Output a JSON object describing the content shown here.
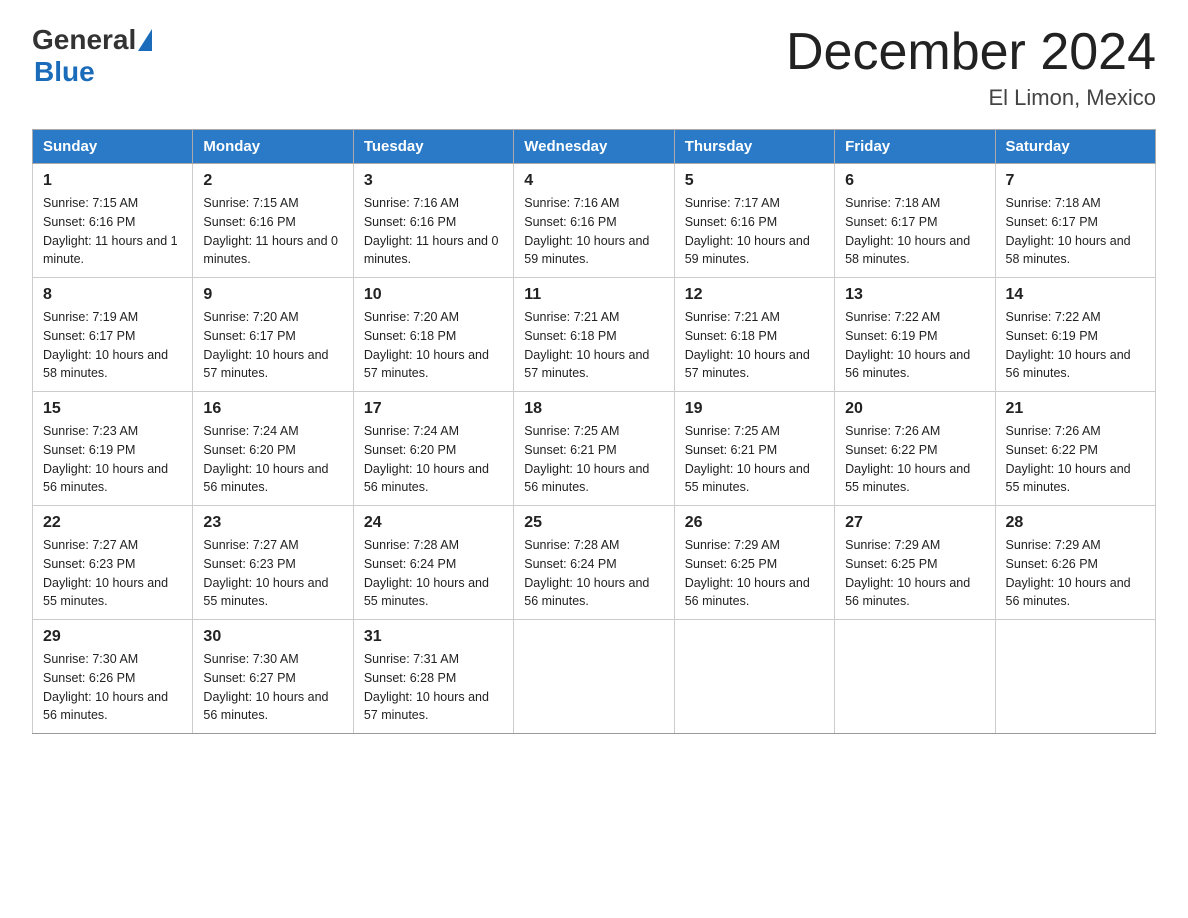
{
  "header": {
    "logo_general": "General",
    "logo_blue": "Blue",
    "month_title": "December 2024",
    "location": "El Limon, Mexico"
  },
  "days_of_week": [
    "Sunday",
    "Monday",
    "Tuesday",
    "Wednesday",
    "Thursday",
    "Friday",
    "Saturday"
  ],
  "weeks": [
    [
      {
        "day": "1",
        "sunrise": "7:15 AM",
        "sunset": "6:16 PM",
        "daylight": "11 hours and 1 minute."
      },
      {
        "day": "2",
        "sunrise": "7:15 AM",
        "sunset": "6:16 PM",
        "daylight": "11 hours and 0 minutes."
      },
      {
        "day": "3",
        "sunrise": "7:16 AM",
        "sunset": "6:16 PM",
        "daylight": "11 hours and 0 minutes."
      },
      {
        "day": "4",
        "sunrise": "7:16 AM",
        "sunset": "6:16 PM",
        "daylight": "10 hours and 59 minutes."
      },
      {
        "day": "5",
        "sunrise": "7:17 AM",
        "sunset": "6:16 PM",
        "daylight": "10 hours and 59 minutes."
      },
      {
        "day": "6",
        "sunrise": "7:18 AM",
        "sunset": "6:17 PM",
        "daylight": "10 hours and 58 minutes."
      },
      {
        "day": "7",
        "sunrise": "7:18 AM",
        "sunset": "6:17 PM",
        "daylight": "10 hours and 58 minutes."
      }
    ],
    [
      {
        "day": "8",
        "sunrise": "7:19 AM",
        "sunset": "6:17 PM",
        "daylight": "10 hours and 58 minutes."
      },
      {
        "day": "9",
        "sunrise": "7:20 AM",
        "sunset": "6:17 PM",
        "daylight": "10 hours and 57 minutes."
      },
      {
        "day": "10",
        "sunrise": "7:20 AM",
        "sunset": "6:18 PM",
        "daylight": "10 hours and 57 minutes."
      },
      {
        "day": "11",
        "sunrise": "7:21 AM",
        "sunset": "6:18 PM",
        "daylight": "10 hours and 57 minutes."
      },
      {
        "day": "12",
        "sunrise": "7:21 AM",
        "sunset": "6:18 PM",
        "daylight": "10 hours and 57 minutes."
      },
      {
        "day": "13",
        "sunrise": "7:22 AM",
        "sunset": "6:19 PM",
        "daylight": "10 hours and 56 minutes."
      },
      {
        "day": "14",
        "sunrise": "7:22 AM",
        "sunset": "6:19 PM",
        "daylight": "10 hours and 56 minutes."
      }
    ],
    [
      {
        "day": "15",
        "sunrise": "7:23 AM",
        "sunset": "6:19 PM",
        "daylight": "10 hours and 56 minutes."
      },
      {
        "day": "16",
        "sunrise": "7:24 AM",
        "sunset": "6:20 PM",
        "daylight": "10 hours and 56 minutes."
      },
      {
        "day": "17",
        "sunrise": "7:24 AM",
        "sunset": "6:20 PM",
        "daylight": "10 hours and 56 minutes."
      },
      {
        "day": "18",
        "sunrise": "7:25 AM",
        "sunset": "6:21 PM",
        "daylight": "10 hours and 56 minutes."
      },
      {
        "day": "19",
        "sunrise": "7:25 AM",
        "sunset": "6:21 PM",
        "daylight": "10 hours and 55 minutes."
      },
      {
        "day": "20",
        "sunrise": "7:26 AM",
        "sunset": "6:22 PM",
        "daylight": "10 hours and 55 minutes."
      },
      {
        "day": "21",
        "sunrise": "7:26 AM",
        "sunset": "6:22 PM",
        "daylight": "10 hours and 55 minutes."
      }
    ],
    [
      {
        "day": "22",
        "sunrise": "7:27 AM",
        "sunset": "6:23 PM",
        "daylight": "10 hours and 55 minutes."
      },
      {
        "day": "23",
        "sunrise": "7:27 AM",
        "sunset": "6:23 PM",
        "daylight": "10 hours and 55 minutes."
      },
      {
        "day": "24",
        "sunrise": "7:28 AM",
        "sunset": "6:24 PM",
        "daylight": "10 hours and 55 minutes."
      },
      {
        "day": "25",
        "sunrise": "7:28 AM",
        "sunset": "6:24 PM",
        "daylight": "10 hours and 56 minutes."
      },
      {
        "day": "26",
        "sunrise": "7:29 AM",
        "sunset": "6:25 PM",
        "daylight": "10 hours and 56 minutes."
      },
      {
        "day": "27",
        "sunrise": "7:29 AM",
        "sunset": "6:25 PM",
        "daylight": "10 hours and 56 minutes."
      },
      {
        "day": "28",
        "sunrise": "7:29 AM",
        "sunset": "6:26 PM",
        "daylight": "10 hours and 56 minutes."
      }
    ],
    [
      {
        "day": "29",
        "sunrise": "7:30 AM",
        "sunset": "6:26 PM",
        "daylight": "10 hours and 56 minutes."
      },
      {
        "day": "30",
        "sunrise": "7:30 AM",
        "sunset": "6:27 PM",
        "daylight": "10 hours and 56 minutes."
      },
      {
        "day": "31",
        "sunrise": "7:31 AM",
        "sunset": "6:28 PM",
        "daylight": "10 hours and 57 minutes."
      },
      null,
      null,
      null,
      null
    ]
  ],
  "labels": {
    "sunrise_prefix": "Sunrise: ",
    "sunset_prefix": "Sunset: ",
    "daylight_prefix": "Daylight: "
  }
}
